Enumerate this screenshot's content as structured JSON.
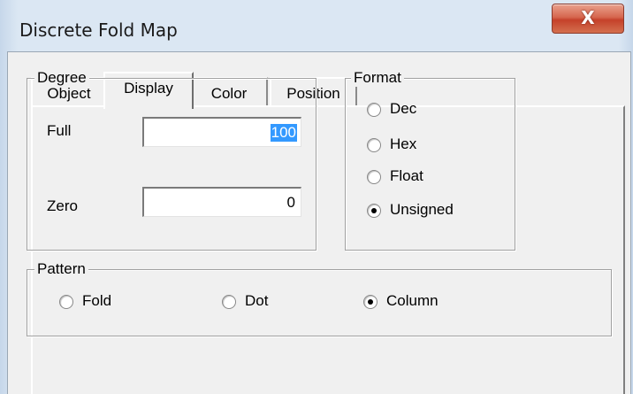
{
  "window": {
    "title": "Discrete Fold Map",
    "close_glyph": "X"
  },
  "tabs": [
    {
      "label": "Object",
      "active": false
    },
    {
      "label": "Display",
      "active": true
    },
    {
      "label": "Color",
      "active": false
    },
    {
      "label": "Position",
      "active": false
    }
  ],
  "degree": {
    "legend": "Degree",
    "full_label": "Full",
    "full_value": "100",
    "zero_label": "Zero",
    "zero_value": "0"
  },
  "format": {
    "legend": "Format",
    "options": [
      {
        "label": "Dec",
        "selected": false
      },
      {
        "label": "Hex",
        "selected": false
      },
      {
        "label": "Float",
        "selected": false
      },
      {
        "label": "Unsigned",
        "selected": true
      }
    ]
  },
  "pattern": {
    "legend": "Pattern",
    "options": [
      {
        "label": "Fold",
        "selected": false
      },
      {
        "label": "Dot",
        "selected": false
      },
      {
        "label": "Column",
        "selected": true
      }
    ]
  }
}
